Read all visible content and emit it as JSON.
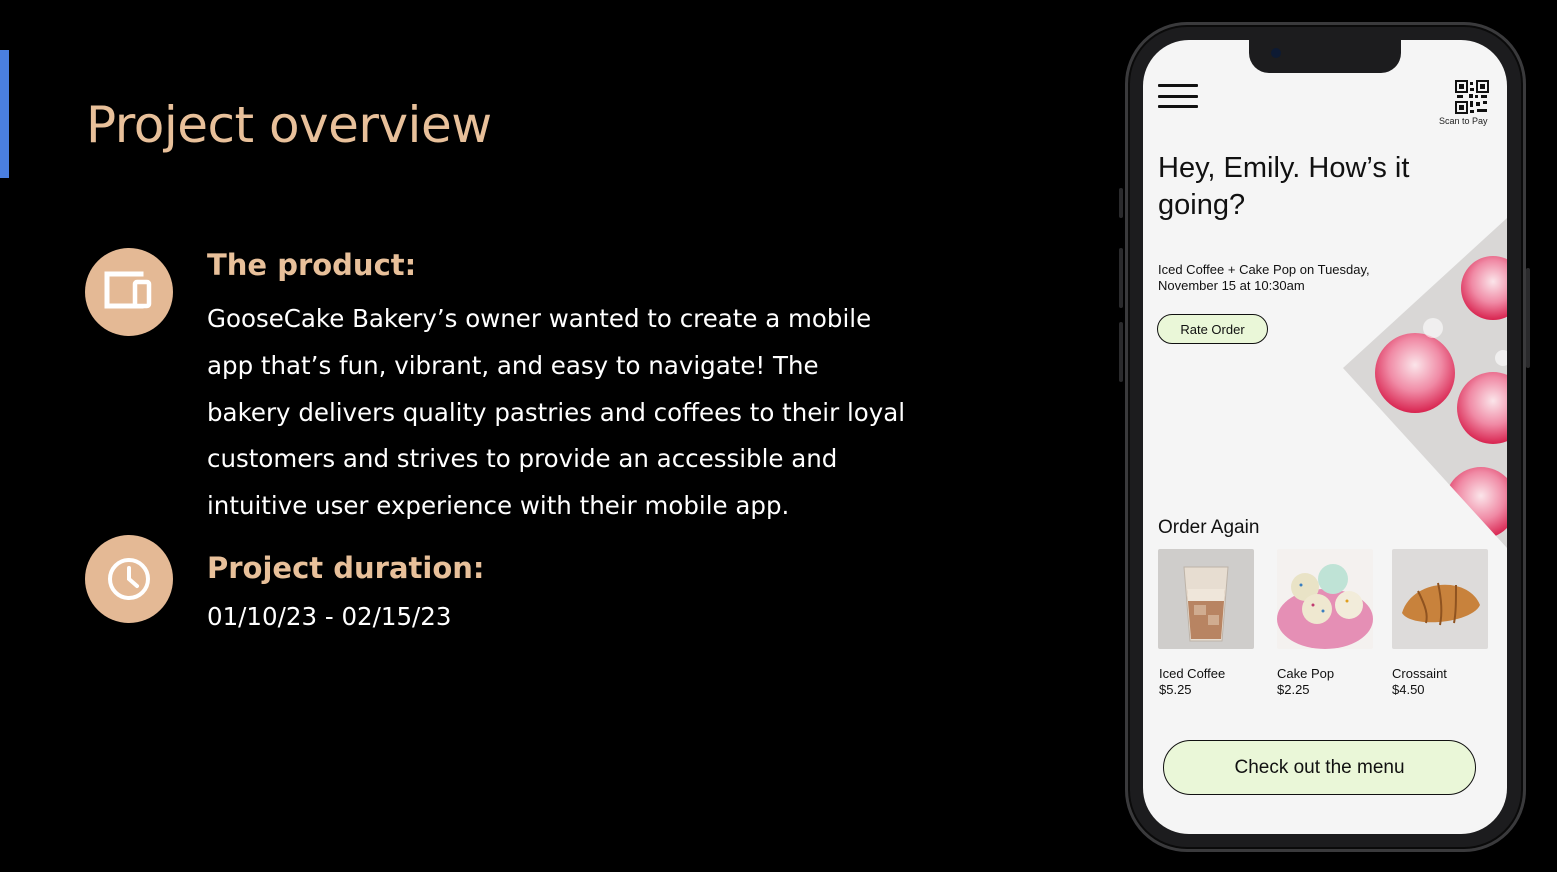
{
  "slide": {
    "title": "Project overview",
    "accent_color": "#4a7fe0",
    "title_color": "#e8c09a",
    "icon_circle_color": "#e4b995"
  },
  "product": {
    "icon": "devices-icon",
    "heading": "The product:",
    "description": "GooseCake Bakery’s owner wanted to create a mobile app that’s fun, vibrant, and easy to navigate! The bakery delivers quality pastries and coffees to their loyal customers and strives to provide an accessible and intuitive user experience with their mobile app."
  },
  "duration": {
    "icon": "clock-icon",
    "heading": "Project duration:",
    "value": "01/10/23 - 02/15/23"
  },
  "phone": {
    "scan_label": "Scan to Pay",
    "greeting": "Hey, Emily. How’s it going?",
    "last_order": "Iced Coffee + Cake Pop on Tuesday, November 15 at 10:30am",
    "rate_button": "Rate Order",
    "order_again_title": "Order Again",
    "items": [
      {
        "name": "Iced Coffee",
        "price": "$5.25",
        "icon": "iced-coffee-image"
      },
      {
        "name": "Cake Pop",
        "price": "$2.25",
        "icon": "cake-pop-image"
      },
      {
        "name": "Crossaint",
        "price": "$4.50",
        "icon": "croissant-image"
      }
    ],
    "menu_button": "Check out the menu",
    "button_fill": "#eaf7d8"
  }
}
